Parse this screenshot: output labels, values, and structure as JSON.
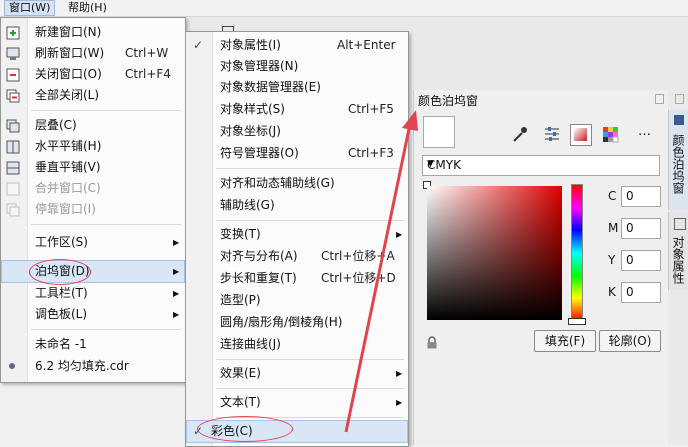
{
  "menubar": {
    "window": "窗口(W)",
    "help": "帮助(H)"
  },
  "window_menu": {
    "items": [
      {
        "label": "新建窗口(N)",
        "shortcut": "",
        "icon": "new-window-icon"
      },
      {
        "label": "刷新窗口(W)",
        "shortcut": "Ctrl+W",
        "icon": "refresh-window-icon"
      },
      {
        "label": "关闭窗口(O)",
        "shortcut": "Ctrl+F4",
        "icon": "close-window-icon"
      },
      {
        "label": "全部关闭(L)",
        "shortcut": "",
        "icon": "close-all-icon"
      },
      {
        "label": "层叠(C)",
        "shortcut": "",
        "icon": "cascade-icon"
      },
      {
        "label": "水平平铺(H)",
        "shortcut": "",
        "icon": "tile-horizontal-icon"
      },
      {
        "label": "垂直平铺(V)",
        "shortcut": "",
        "icon": "tile-vertical-icon"
      },
      {
        "label": "合并窗口(C)",
        "shortcut": "",
        "icon": "merge-window-icon",
        "disabled": true
      },
      {
        "label": "停靠窗口(I)",
        "shortcut": "",
        "icon": "dock-window-icon",
        "disabled": true
      },
      {
        "label": "工作区(S)",
        "submenu": true
      },
      {
        "label": "泊坞窗(D)",
        "submenu": true
      },
      {
        "label": "工具栏(T)",
        "submenu": true
      },
      {
        "label": "调色板(L)",
        "submenu": true
      },
      {
        "label": "未命名 -1"
      },
      {
        "label": "6.2 均匀填充.cdr"
      }
    ]
  },
  "dockers_menu": {
    "items": [
      {
        "label": "对象属性(I)",
        "shortcut": "Alt+Enter",
        "checked": true
      },
      {
        "label": "对象管理器(N)"
      },
      {
        "label": "对象数据管理器(E)"
      },
      {
        "label": "对象样式(S)",
        "shortcut": "Ctrl+F5"
      },
      {
        "label": "对象坐标(J)"
      },
      {
        "label": "符号管理器(O)",
        "shortcut": "Ctrl+F3"
      },
      {
        "label": "对齐和动态辅助线(G)"
      },
      {
        "label": "辅助线(G)"
      },
      {
        "label": "变换(T)",
        "submenu": true
      },
      {
        "label": "对齐与分布(A)",
        "shortcut": "Ctrl+位移+A"
      },
      {
        "label": "步长和重复(T)",
        "shortcut": "Ctrl+位移+D"
      },
      {
        "label": "造型(P)"
      },
      {
        "label": "圆角/扇形角/倒棱角(H)"
      },
      {
        "label": "连接曲线(J)"
      },
      {
        "label": "效果(E)",
        "submenu": true
      },
      {
        "label": "文本(T)",
        "submenu": true
      },
      {
        "label": "彩色(C)",
        "checked": true
      }
    ]
  },
  "color_docker": {
    "title": "颜色泊坞窗",
    "model": "CMYK",
    "fields": [
      {
        "label": "C",
        "value": "0"
      },
      {
        "label": "M",
        "value": "0"
      },
      {
        "label": "Y",
        "value": "0"
      },
      {
        "label": "K",
        "value": "0"
      }
    ],
    "fill_button": "填充(F)",
    "outline_button": "轮廓(O)",
    "more": "…"
  },
  "side_tabs": {
    "color_tab": "颜色泊坞窗",
    "props_tab": "对象属性"
  },
  "colors": {
    "accent_red": "#e0454f",
    "highlight": "#d9e6f6"
  }
}
